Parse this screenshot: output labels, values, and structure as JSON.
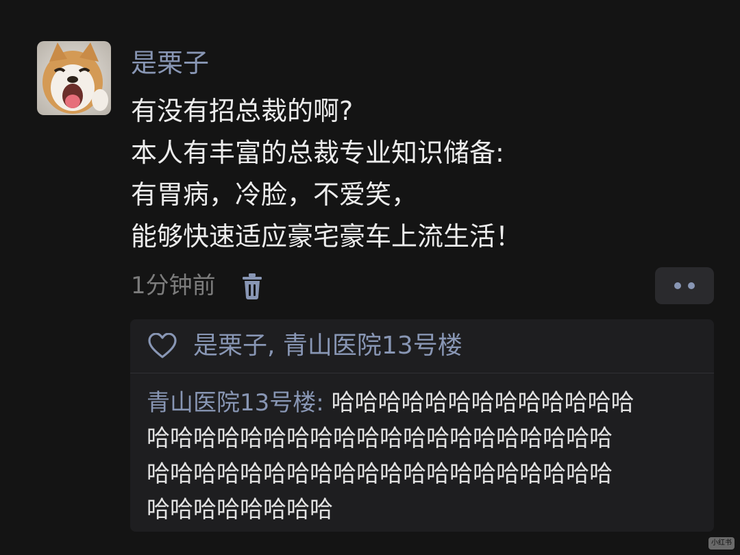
{
  "comment": {
    "author": "是栗子",
    "lines": [
      "有没有招总裁的啊?",
      "本人有丰富的总裁专业知识储备:",
      "有胃病，冷脸，不爱笑，",
      "能够快速适应豪宅豪车上流生活！"
    ],
    "time": "1分钟前"
  },
  "likes": {
    "text": "是栗子, 青山医院13号楼"
  },
  "reply": {
    "author": "青山医院13号楼",
    "separator": ": ",
    "lines": [
      "哈哈哈哈哈哈哈哈哈哈哈哈哈",
      "哈哈哈哈哈哈哈哈哈哈哈哈哈哈哈哈哈哈哈哈",
      "哈哈哈哈哈哈哈哈哈哈哈哈哈哈哈哈哈哈哈哈",
      "哈哈哈哈哈哈哈哈"
    ]
  },
  "watermark": "小红书",
  "colors": {
    "background": "#141414",
    "name": "#8896b4",
    "text": "#ececec",
    "meta": "#7c7c7c",
    "panel": "#1e1e20"
  },
  "icons": [
    "dog-avatar",
    "trash-icon",
    "more-dots-icon",
    "heart-icon"
  ]
}
